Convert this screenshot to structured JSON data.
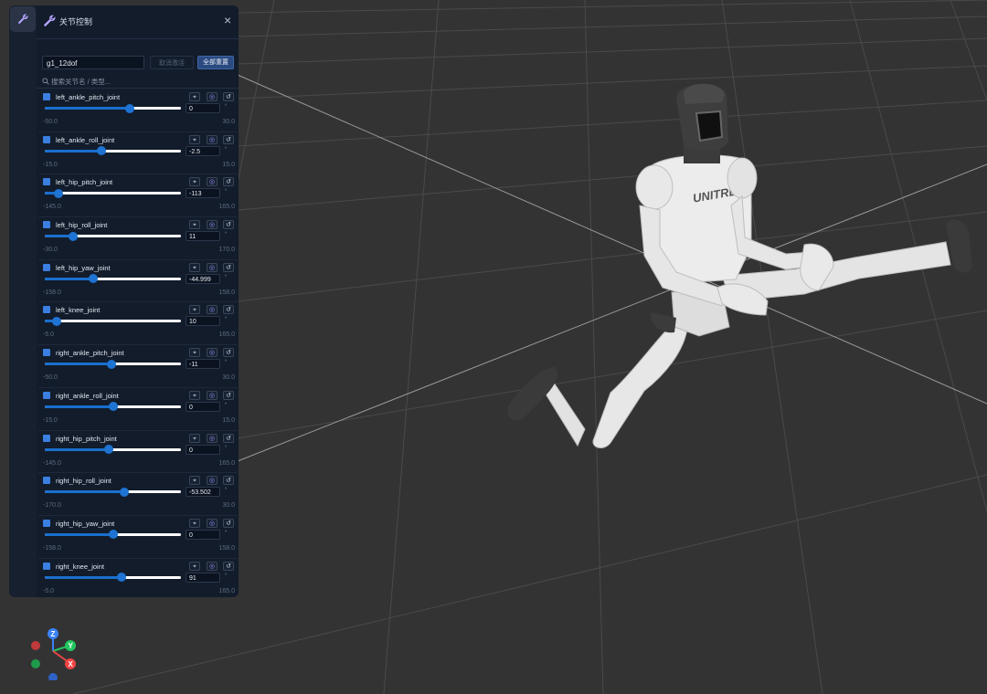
{
  "panel": {
    "title": "关节控制",
    "model_name": "g1_12dof",
    "cancel_label": "取消激活",
    "reset_all_label": "全部重置",
    "search_placeholder": "搜索关节名 / 类型...",
    "unit": "°"
  },
  "joints": [
    {
      "name": "left_ankle_pitch_joint",
      "value": "0",
      "min": "-50.0",
      "max": "30.0",
      "fraction": 0.625
    },
    {
      "name": "left_ankle_roll_joint",
      "value": "-2.5",
      "min": "-15.0",
      "max": "15.0",
      "fraction": 0.417
    },
    {
      "name": "left_hip_pitch_joint",
      "value": "-113",
      "min": "-145.0",
      "max": "165.0",
      "fraction": 0.103
    },
    {
      "name": "left_hip_roll_joint",
      "value": "11",
      "min": "-30.0",
      "max": "170.0",
      "fraction": 0.205
    },
    {
      "name": "left_hip_yaw_joint",
      "value": "-44.999",
      "min": "-158.0",
      "max": "158.0",
      "fraction": 0.358
    },
    {
      "name": "left_knee_joint",
      "value": "10",
      "min": "-5.0",
      "max": "165.0",
      "fraction": 0.088
    },
    {
      "name": "right_ankle_pitch_joint",
      "value": "-11",
      "min": "-50.0",
      "max": "30.0",
      "fraction": 0.488
    },
    {
      "name": "right_ankle_roll_joint",
      "value": "0",
      "min": "-15.0",
      "max": "15.0",
      "fraction": 0.5
    },
    {
      "name": "right_hip_pitch_joint",
      "value": "0",
      "min": "-145.0",
      "max": "165.0",
      "fraction": 0.468
    },
    {
      "name": "right_hip_roll_joint",
      "value": "-53.502",
      "min": "-170.0",
      "max": "30.0",
      "fraction": 0.582
    },
    {
      "name": "right_hip_yaw_joint",
      "value": "0",
      "min": "-158.0",
      "max": "158.0",
      "fraction": 0.5
    },
    {
      "name": "right_knee_joint",
      "value": "91",
      "min": "-5.0",
      "max": "165.0",
      "fraction": 0.565
    }
  ],
  "robot": {
    "chest_logo": "UNITREE"
  },
  "gizmo": {
    "z_label": "Z",
    "y_label": "Y",
    "x_label": "X",
    "colors": {
      "z": "#3b82f6",
      "y": "#22c55e",
      "x": "#ef4444"
    }
  }
}
